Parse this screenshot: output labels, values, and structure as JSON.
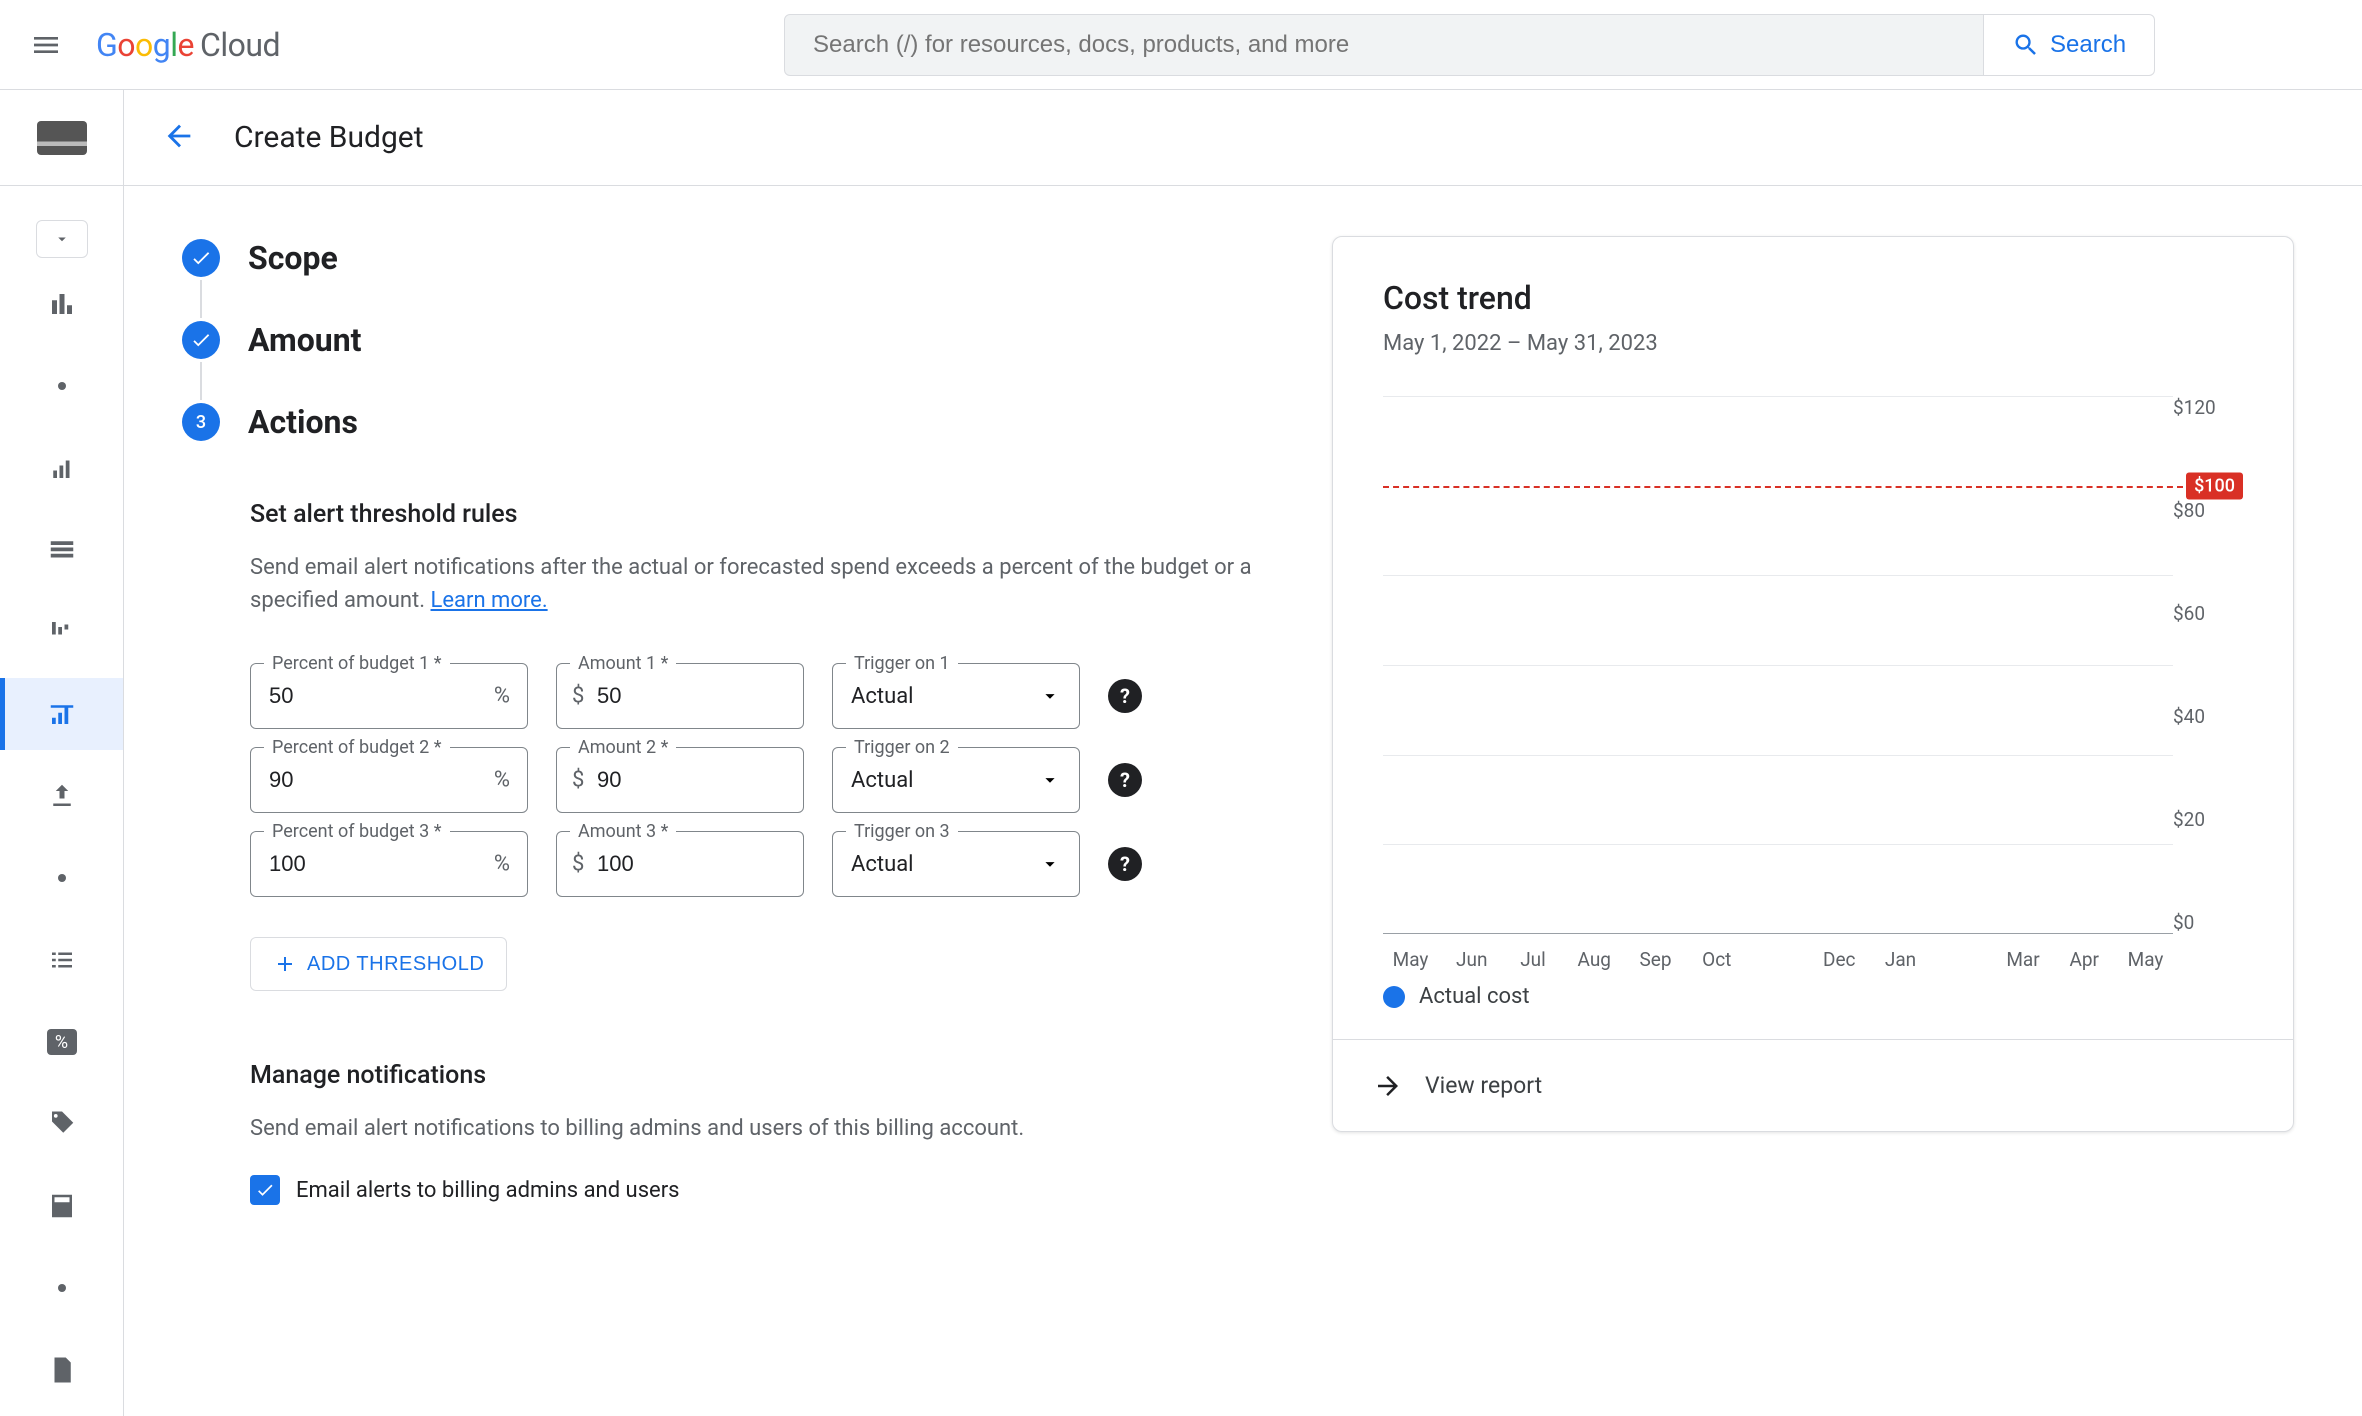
{
  "header": {
    "logo_cloud_word": "Cloud",
    "search_placeholder": "Search (/) for resources, docs, products, and more",
    "search_button": "Search"
  },
  "page": {
    "title": "Create Budget"
  },
  "steps": {
    "scope": "Scope",
    "amount": "Amount",
    "actions": "Actions",
    "actions_number": "3"
  },
  "thresholds": {
    "heading": "Set alert threshold rules",
    "desc": "Send email alert notifications after the actual or forecasted spend exceeds a percent of the budget or a specified amount. ",
    "learn_more": "Learn more.",
    "add_button": "ADD THRESHOLD",
    "labels": {
      "percent_prefix": "Percent of budget ",
      "amount_prefix": "Amount ",
      "trigger_prefix": "Trigger on ",
      "required_suffix": " *"
    },
    "rows": [
      {
        "percent": "50",
        "amount": "50",
        "trigger": "Actual"
      },
      {
        "percent": "90",
        "amount": "90",
        "trigger": "Actual"
      },
      {
        "percent": "100",
        "amount": "100",
        "trigger": "Actual"
      }
    ]
  },
  "notifications": {
    "heading": "Manage notifications",
    "desc": "Send email alert notifications to billing admins and users of this billing account.",
    "email_checkbox_label": "Email alerts to billing admins and users"
  },
  "trend": {
    "title": "Cost trend",
    "date_range": "May 1, 2022 – May 31, 2023",
    "legend_actual": "Actual cost",
    "view_report": "View report"
  },
  "chart_data": {
    "type": "bar",
    "title": "Cost trend",
    "xlabel": "",
    "ylabel": "",
    "ylim": [
      0,
      120
    ],
    "y_ticks": [
      0,
      20,
      40,
      60,
      80,
      120
    ],
    "y_tick_labels": [
      "$0",
      "$20",
      "$40",
      "$60",
      "$80",
      "$120"
    ],
    "budget_line": {
      "value": 100,
      "label": "$100"
    },
    "categories": [
      "May",
      "Jun",
      "Jul",
      "Aug",
      "Sep",
      "Oct",
      "",
      "Dec",
      "Jan",
      "",
      "Mar",
      "Apr",
      "May"
    ],
    "series": [
      {
        "name": "Actual cost",
        "values": [
          0,
          0,
          0,
          0,
          0,
          0,
          0,
          0,
          0,
          0,
          0,
          0,
          0
        ]
      }
    ]
  }
}
